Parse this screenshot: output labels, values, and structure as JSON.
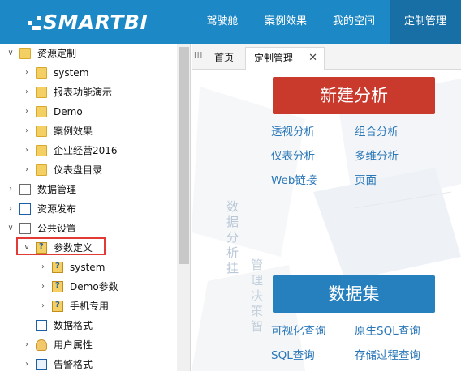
{
  "app": {
    "logo_text": "SMARTBI"
  },
  "topnav": [
    {
      "label": "驾驶舱",
      "active": false
    },
    {
      "label": "案例效果",
      "active": false
    },
    {
      "label": "我的空间",
      "active": false
    },
    {
      "label": "定制管理",
      "active": true
    }
  ],
  "tree": [
    {
      "label": "资源定制",
      "arrow": "expanded",
      "icon": "folder-icon"
    },
    {
      "label": "system",
      "arrow": "collapsed",
      "icon": "folder-icon"
    },
    {
      "label": "报表功能演示",
      "arrow": "collapsed",
      "icon": "folder-icon"
    },
    {
      "label": "Demo",
      "arrow": "collapsed",
      "icon": "folder-icon"
    },
    {
      "label": "案例效果",
      "arrow": "collapsed",
      "icon": "folder-icon"
    },
    {
      "label": "企业经营2016",
      "arrow": "collapsed",
      "icon": "folder-icon"
    },
    {
      "label": "仪表盘目录",
      "arrow": "collapsed",
      "icon": "folder-icon"
    },
    {
      "label": "数据管理",
      "arrow": "collapsed",
      "icon": "data-manage-icon"
    },
    {
      "label": "资源发布",
      "arrow": "collapsed",
      "icon": "publish-icon"
    },
    {
      "label": "公共设置",
      "arrow": "expanded",
      "icon": "settings-icon"
    },
    {
      "label": "参数定义",
      "arrow": "expanded",
      "icon": "param-folder-icon",
      "highlighted": true
    },
    {
      "label": "system",
      "arrow": "collapsed",
      "icon": "param-icon"
    },
    {
      "label": "Demo参数",
      "arrow": "collapsed",
      "icon": "param-icon"
    },
    {
      "label": "手机专用",
      "arrow": "collapsed",
      "icon": "param-icon"
    },
    {
      "label": "数据格式",
      "arrow": "none",
      "icon": "data-format-icon"
    },
    {
      "label": "用户属性",
      "arrow": "collapsed",
      "icon": "hand-icon"
    },
    {
      "label": "告警格式",
      "arrow": "collapsed",
      "icon": "alert-icon"
    }
  ],
  "tabs": [
    {
      "label": "首页",
      "active": false
    },
    {
      "label": "定制管理",
      "active": true,
      "close": "✕"
    }
  ],
  "tab_grip": "III",
  "main": {
    "new_analysis": {
      "button": "新建分析",
      "links": [
        "透视分析",
        "组合分析",
        "仪表分析",
        "多维分析",
        "Web链接",
        "页面"
      ]
    },
    "dataset": {
      "button": "数据集",
      "links": [
        "可视化查询",
        "原生SQL查询",
        "SQL查询",
        "存储过程查询"
      ]
    },
    "bg_text_1": "数据分析挂",
    "bg_text_2": "管理决策智"
  },
  "colors": {
    "topbar": "#1d88c6",
    "active_nav": "#176fa6",
    "red_button": "#c9392c",
    "blue_button": "#2680be",
    "link": "#2a77b8",
    "highlight_border": "#e23a36"
  }
}
